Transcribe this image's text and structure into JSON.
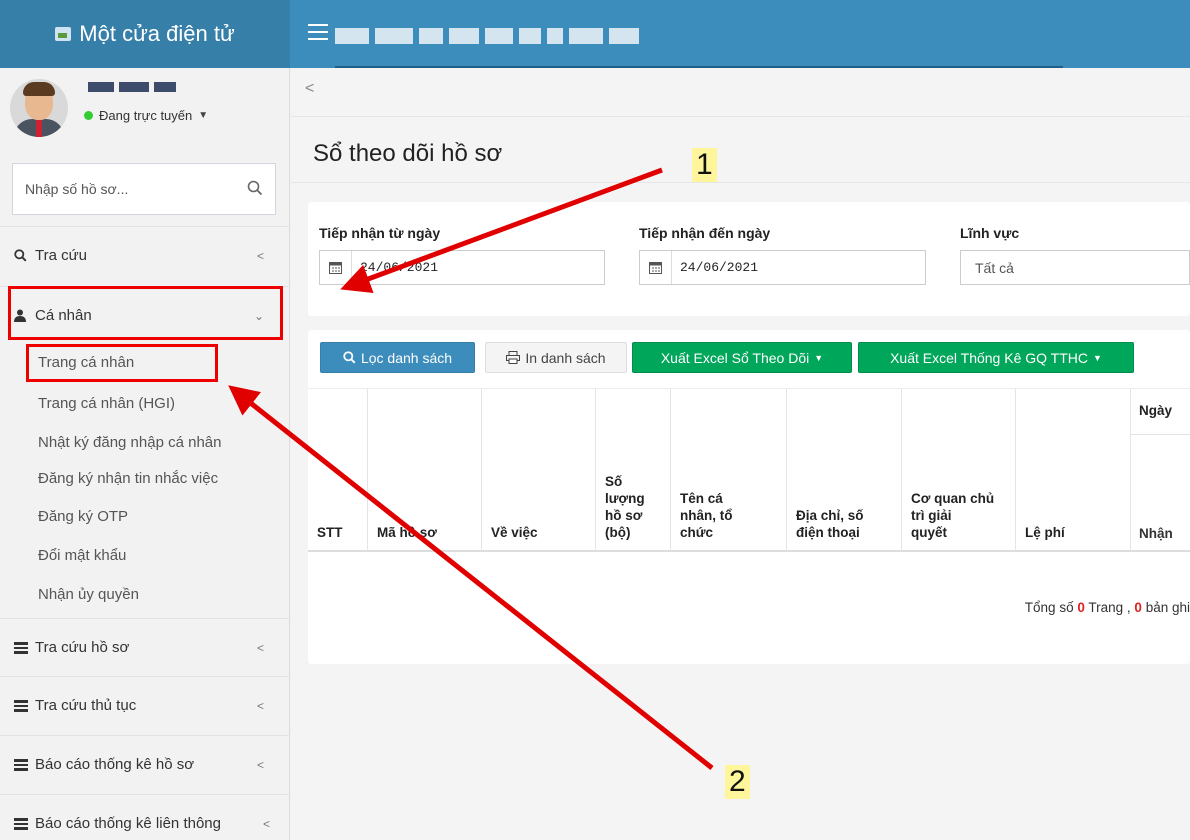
{
  "app": {
    "title": "Một cửa điện tử"
  },
  "user": {
    "status": "Đang trực tuyến"
  },
  "sidebar": {
    "search_placeholder": "Nhập số hồ sơ...",
    "menu": {
      "tra_cuu": "Tra cứu",
      "ca_nhan": "Cá nhân",
      "tra_cuu_ho_so": "Tra cứu hồ sơ",
      "tra_cuu_thu_tuc": "Tra cứu thủ tục",
      "bao_cao_ho_so": "Báo cáo thống kê hồ sơ",
      "bao_cao_lien_thong": "Báo cáo thống kê liên thông"
    },
    "ca_nhan_items": [
      "Trang cá nhân",
      "Trang cá nhân (HGI)",
      "Nhật ký đăng nhập cá nhân",
      "Đăng ký nhận tin nhắc việc",
      "Đăng ký OTP",
      "Đổi mật khẩu",
      "Nhận ủy quyền"
    ]
  },
  "page": {
    "title": "Sổ theo dõi hồ sơ"
  },
  "filters": {
    "from_label": "Tiếp nhận từ ngày",
    "from_value": "24/06/2021",
    "to_label": "Tiếp nhận đến ngày",
    "to_value": "24/06/2021",
    "field_label": "Lĩnh vực",
    "field_value": "Tất cả"
  },
  "toolbar": {
    "filter_btn": "Lọc danh sách",
    "print_btn": "In danh sách",
    "excel_btn": "Xuất Excel Sổ Theo Dõi",
    "excel_stats_btn": "Xuất Excel Thống Kê GQ TTHC"
  },
  "table": {
    "headers": {
      "stt": "STT",
      "ma_ho_so": "Mã hồ sơ",
      "ve_viec": "Về việc",
      "so_luong": [
        "Số",
        "lượng",
        "hồ sơ",
        "(bộ)"
      ],
      "ten": [
        "Tên cá",
        "nhân, tổ",
        "chức"
      ],
      "dia_chi": [
        "Địa chỉ, số",
        "điện thoại"
      ],
      "co_quan": [
        "Cơ quan chủ",
        "trì giải",
        "quyết"
      ],
      "le_phi": "Lệ phí",
      "ngay_group": "Ngày",
      "nhan": "Nhận"
    }
  },
  "pager": {
    "prefix": "Tổng số",
    "pages": "0",
    "middle": "Trang ,",
    "records": "0",
    "suffix": "bản ghi"
  },
  "annotations": {
    "label_1": "1",
    "label_2": "2",
    "color": "#e00000"
  }
}
